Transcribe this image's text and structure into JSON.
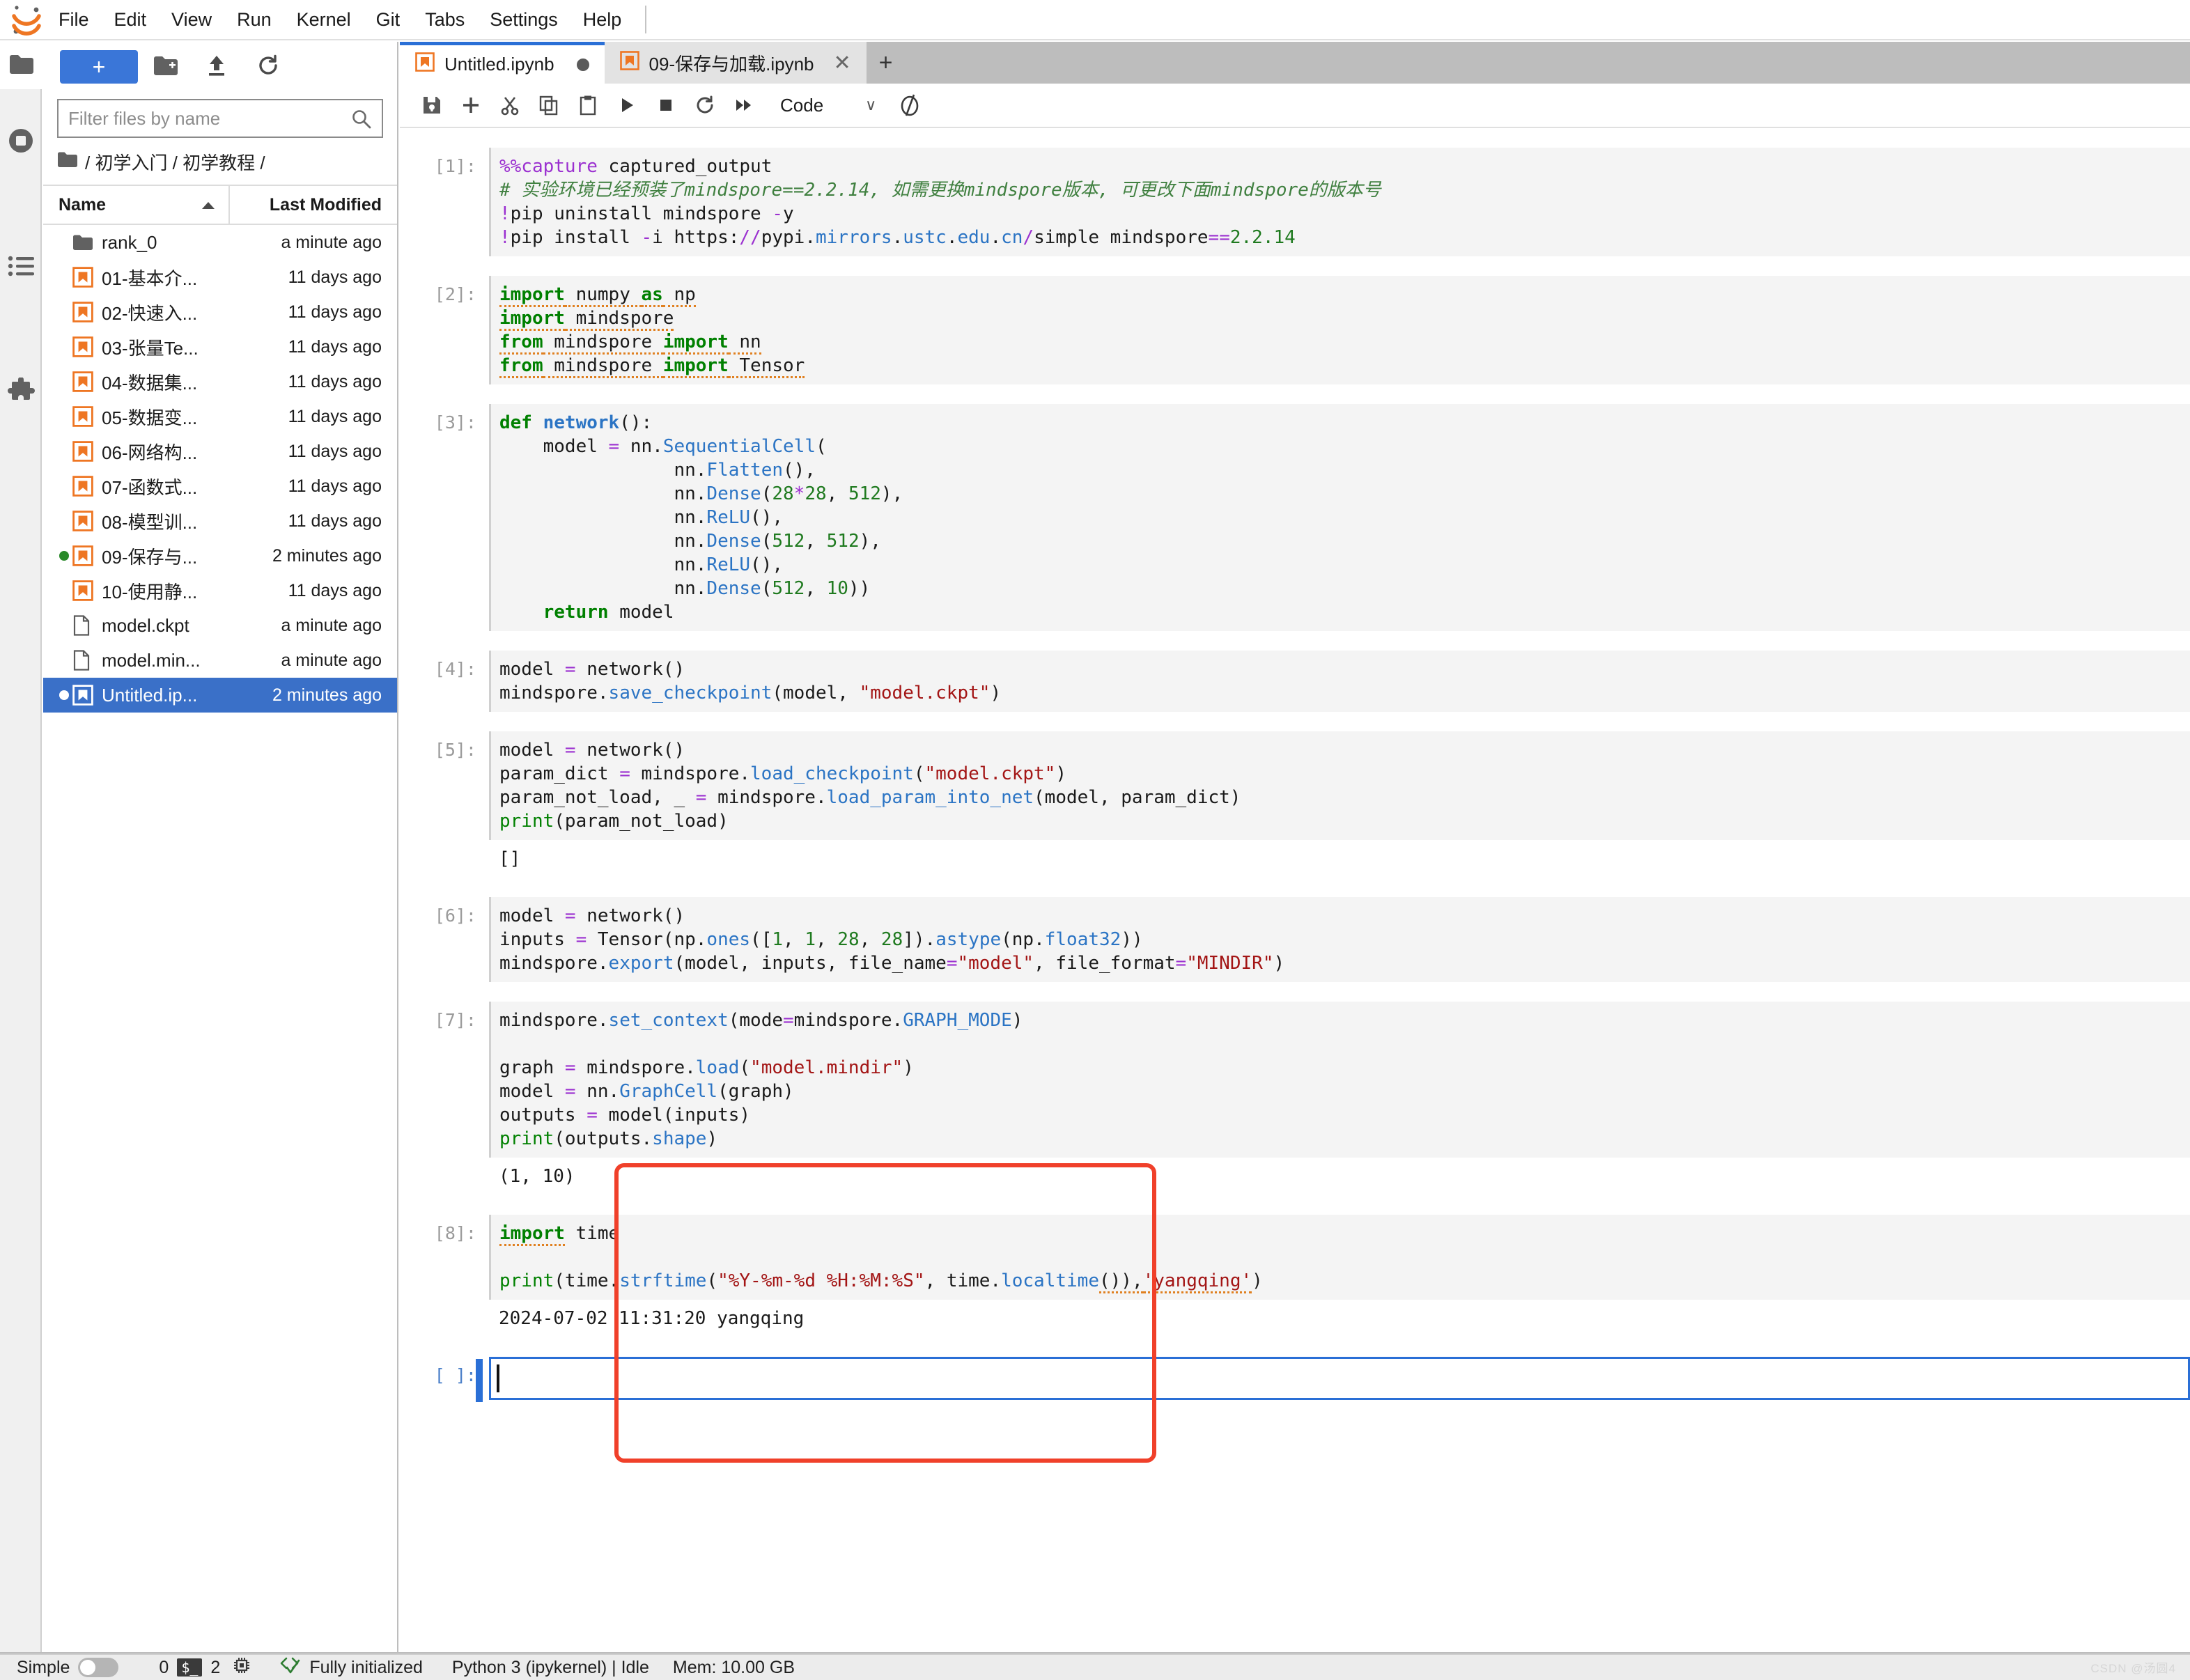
{
  "app": {
    "title": "JupyterLab",
    "logo_icon": "jupyter-logo-icon"
  },
  "menubar": {
    "items": [
      {
        "label": "File"
      },
      {
        "label": "Edit"
      },
      {
        "label": "View"
      },
      {
        "label": "Run"
      },
      {
        "label": "Kernel"
      },
      {
        "label": "Git"
      },
      {
        "label": "Tabs"
      },
      {
        "label": "Settings"
      },
      {
        "label": "Help"
      }
    ]
  },
  "rail": {
    "icons": [
      {
        "name": "folder-icon",
        "label": "File Browser"
      },
      {
        "name": "running-terminals-icon",
        "label": "Running Terminals and Kernels"
      },
      {
        "name": "commands-list-icon",
        "label": "Commands"
      },
      {
        "name": "extension-puzzle-icon",
        "label": "Extension Manager"
      }
    ]
  },
  "browser": {
    "new_launcher_label": "+",
    "toolbar_icons": [
      "new-folder-icon",
      "upload-icon",
      "refresh-icon"
    ],
    "search": {
      "placeholder": "Filter files by name",
      "value": "",
      "icon": "search-icon"
    },
    "breadcrumb": "/ 初学入门 / 初学教程 /",
    "columns": {
      "name": "Name",
      "last_modified": "Last Modified",
      "sort_icon": "sort-ascending-icon"
    },
    "files": [
      {
        "name": "rank_0",
        "modified": "a minute ago",
        "icon": "folder-icon",
        "dot": "none",
        "selected": false
      },
      {
        "name": "01-基本介...",
        "modified": "11 days ago",
        "icon": "notebook-icon",
        "dot": "none",
        "selected": false
      },
      {
        "name": "02-快速入...",
        "modified": "11 days ago",
        "icon": "notebook-icon",
        "dot": "none",
        "selected": false
      },
      {
        "name": "03-张量Te...",
        "modified": "11 days ago",
        "icon": "notebook-icon",
        "dot": "none",
        "selected": false
      },
      {
        "name": "04-数据集...",
        "modified": "11 days ago",
        "icon": "notebook-icon",
        "dot": "none",
        "selected": false
      },
      {
        "name": "05-数据变...",
        "modified": "11 days ago",
        "icon": "notebook-icon",
        "dot": "none",
        "selected": false
      },
      {
        "name": "06-网络构...",
        "modified": "11 days ago",
        "icon": "notebook-icon",
        "dot": "none",
        "selected": false
      },
      {
        "name": "07-函数式...",
        "modified": "11 days ago",
        "icon": "notebook-icon",
        "dot": "none",
        "selected": false
      },
      {
        "name": "08-模型训...",
        "modified": "11 days ago",
        "icon": "notebook-icon",
        "dot": "none",
        "selected": false
      },
      {
        "name": "09-保存与...",
        "modified": "2 minutes ago",
        "icon": "notebook-icon",
        "dot": "green",
        "selected": false
      },
      {
        "name": "10-使用静...",
        "modified": "11 days ago",
        "icon": "notebook-icon",
        "dot": "none",
        "selected": false
      },
      {
        "name": "model.ckpt",
        "modified": "a minute ago",
        "icon": "file-icon",
        "dot": "none",
        "selected": false
      },
      {
        "name": "model.min...",
        "modified": "a minute ago",
        "icon": "file-icon",
        "dot": "none",
        "selected": false
      },
      {
        "name": "Untitled.ip...",
        "modified": "2 minutes ago",
        "icon": "notebook-icon",
        "dot": "white",
        "selected": true
      }
    ]
  },
  "dock": {
    "tabs": [
      {
        "label": "Untitled.ipynb",
        "active": true,
        "dirty": true,
        "icon": "notebook-icon"
      },
      {
        "label": "09-保存与加载.ipynb",
        "active": false,
        "dirty": false,
        "icon": "notebook-icon",
        "close_label": "✕"
      }
    ],
    "add_tab_label": "+"
  },
  "notebook_toolbar": {
    "buttons": [
      {
        "name": "save-icon",
        "title": "Save"
      },
      {
        "name": "insert-cell-icon",
        "title": "Insert a cell below"
      },
      {
        "name": "cut-icon",
        "title": "Cut"
      },
      {
        "name": "copy-icon",
        "title": "Copy"
      },
      {
        "name": "paste-icon",
        "title": "Paste"
      },
      {
        "name": "run-icon",
        "title": "Run"
      },
      {
        "name": "stop-icon",
        "title": "Interrupt kernel"
      },
      {
        "name": "restart-icon",
        "title": "Restart kernel"
      },
      {
        "name": "restart-run-all-icon",
        "title": "Restart and run all"
      }
    ],
    "cell_type": {
      "value": "Code",
      "chevron": "∨"
    },
    "kernel_status_icon": "kernel-busy-circle-icon"
  },
  "cells": [
    {
      "prompt": "[1]:",
      "type": "code",
      "lines": [
        [
          {
            "t": "%%capture",
            "c": "mg"
          },
          {
            "t": " captured_output",
            "c": ""
          }
        ],
        [
          {
            "t": "# 实验环境已经预装了mindspore==2.2.14, 如需更换mindspore版本, 可更改下面mindspore的版本号",
            "c": "cm"
          }
        ],
        [
          {
            "t": "!",
            "c": "op"
          },
          {
            "t": "pip uninstall mindspore ",
            "c": ""
          },
          {
            "t": "-",
            "c": "op"
          },
          {
            "t": "y",
            "c": ""
          }
        ],
        [
          {
            "t": "!",
            "c": "op"
          },
          {
            "t": "pip install ",
            "c": ""
          },
          {
            "t": "-",
            "c": "op"
          },
          {
            "t": "i https:",
            "c": ""
          },
          {
            "t": "//",
            "c": "op"
          },
          {
            "t": "pypi.",
            "c": ""
          },
          {
            "t": "mirrors",
            "c": "fn"
          },
          {
            "t": ".",
            "c": ""
          },
          {
            "t": "ustc",
            "c": "fn"
          },
          {
            "t": ".",
            "c": ""
          },
          {
            "t": "edu",
            "c": "fn"
          },
          {
            "t": ".",
            "c": ""
          },
          {
            "t": "cn",
            "c": "fn"
          },
          {
            "t": "/",
            "c": "op"
          },
          {
            "t": "simple mindspore",
            "c": ""
          },
          {
            "t": "==",
            "c": "op"
          },
          {
            "t": "2.2.14",
            "c": "nu"
          }
        ]
      ],
      "output": null
    },
    {
      "prompt": "[2]:",
      "type": "code",
      "lines": [
        [
          {
            "t": "import",
            "c": "k lint"
          },
          {
            "t": " numpy ",
            "c": "lint"
          },
          {
            "t": "as",
            "c": "k lint"
          },
          {
            "t": " np",
            "c": "lint"
          }
        ],
        [
          {
            "t": "import",
            "c": "k lint"
          },
          {
            "t": " mindspore",
            "c": "lint"
          }
        ],
        [
          {
            "t": "from",
            "c": "k lint"
          },
          {
            "t": " mindspore ",
            "c": "lint"
          },
          {
            "t": "import",
            "c": "k lint"
          },
          {
            "t": " nn",
            "c": "lint"
          }
        ],
        [
          {
            "t": "from",
            "c": "k lint"
          },
          {
            "t": " mindspore ",
            "c": "lint"
          },
          {
            "t": "import",
            "c": "k lint"
          },
          {
            "t": " Tensor",
            "c": "lint"
          }
        ]
      ],
      "output": null
    },
    {
      "prompt": "[3]:",
      "type": "code",
      "lines": [
        [
          {
            "t": "def",
            "c": "k"
          },
          {
            "t": " ",
            "c": ""
          },
          {
            "t": "network",
            "c": "df"
          },
          {
            "t": "():",
            "c": ""
          }
        ],
        [
          {
            "t": "    model ",
            "c": ""
          },
          {
            "t": "=",
            "c": "op"
          },
          {
            "t": " nn.",
            "c": ""
          },
          {
            "t": "SequentialCell",
            "c": "fn"
          },
          {
            "t": "(",
            "c": ""
          }
        ],
        [
          {
            "t": "                nn.",
            "c": ""
          },
          {
            "t": "Flatten",
            "c": "fn"
          },
          {
            "t": "(),",
            "c": ""
          }
        ],
        [
          {
            "t": "                nn.",
            "c": ""
          },
          {
            "t": "Dense",
            "c": "fn"
          },
          {
            "t": "(",
            "c": ""
          },
          {
            "t": "28",
            "c": "nu"
          },
          {
            "t": "*",
            "c": "op"
          },
          {
            "t": "28",
            "c": "nu"
          },
          {
            "t": ", ",
            "c": ""
          },
          {
            "t": "512",
            "c": "nu"
          },
          {
            "t": "),",
            "c": ""
          }
        ],
        [
          {
            "t": "                nn.",
            "c": ""
          },
          {
            "t": "ReLU",
            "c": "fn"
          },
          {
            "t": "(),",
            "c": ""
          }
        ],
        [
          {
            "t": "                nn.",
            "c": ""
          },
          {
            "t": "Dense",
            "c": "fn"
          },
          {
            "t": "(",
            "c": ""
          },
          {
            "t": "512",
            "c": "nu"
          },
          {
            "t": ", ",
            "c": ""
          },
          {
            "t": "512",
            "c": "nu"
          },
          {
            "t": "),",
            "c": ""
          }
        ],
        [
          {
            "t": "                nn.",
            "c": ""
          },
          {
            "t": "ReLU",
            "c": "fn"
          },
          {
            "t": "(),",
            "c": ""
          }
        ],
        [
          {
            "t": "                nn.",
            "c": ""
          },
          {
            "t": "Dense",
            "c": "fn"
          },
          {
            "t": "(",
            "c": ""
          },
          {
            "t": "512",
            "c": "nu"
          },
          {
            "t": ", ",
            "c": ""
          },
          {
            "t": "10",
            "c": "nu"
          },
          {
            "t": "))",
            "c": ""
          }
        ],
        [
          {
            "t": "    ",
            "c": ""
          },
          {
            "t": "return",
            "c": "k"
          },
          {
            "t": " model",
            "c": ""
          }
        ]
      ],
      "output": null
    },
    {
      "prompt": "[4]:",
      "type": "code",
      "lines": [
        [
          {
            "t": "model ",
            "c": ""
          },
          {
            "t": "=",
            "c": "op"
          },
          {
            "t": " network()",
            "c": ""
          }
        ],
        [
          {
            "t": "mindspore.",
            "c": ""
          },
          {
            "t": "save_checkpoint",
            "c": "fn"
          },
          {
            "t": "(model, ",
            "c": ""
          },
          {
            "t": "\"model.ckpt\"",
            "c": "st"
          },
          {
            "t": ")",
            "c": ""
          }
        ]
      ],
      "output": null
    },
    {
      "prompt": "[5]:",
      "type": "code",
      "lines": [
        [
          {
            "t": "model ",
            "c": ""
          },
          {
            "t": "=",
            "c": "op"
          },
          {
            "t": " network()",
            "c": ""
          }
        ],
        [
          {
            "t": "param_dict ",
            "c": ""
          },
          {
            "t": "=",
            "c": "op"
          },
          {
            "t": " mindspore.",
            "c": ""
          },
          {
            "t": "load_checkpoint",
            "c": "fn"
          },
          {
            "t": "(",
            "c": ""
          },
          {
            "t": "\"model.ckpt\"",
            "c": "st"
          },
          {
            "t": ")",
            "c": ""
          }
        ],
        [
          {
            "t": "param_not_load, _ ",
            "c": ""
          },
          {
            "t": "=",
            "c": "op"
          },
          {
            "t": " mindspore.",
            "c": ""
          },
          {
            "t": "load_param_into_net",
            "c": "fn"
          },
          {
            "t": "(model, param_dict)",
            "c": ""
          }
        ],
        [
          {
            "t": "print",
            "c": "kw"
          },
          {
            "t": "(param_not_load)",
            "c": ""
          }
        ]
      ],
      "output": "[]"
    },
    {
      "prompt": "[6]:",
      "type": "code",
      "lines": [
        [
          {
            "t": "model ",
            "c": ""
          },
          {
            "t": "=",
            "c": "op"
          },
          {
            "t": " network()",
            "c": ""
          }
        ],
        [
          {
            "t": "inputs ",
            "c": ""
          },
          {
            "t": "=",
            "c": "op"
          },
          {
            "t": " Tensor(np.",
            "c": ""
          },
          {
            "t": "ones",
            "c": "fn"
          },
          {
            "t": "([",
            "c": ""
          },
          {
            "t": "1",
            "c": "nu"
          },
          {
            "t": ", ",
            "c": ""
          },
          {
            "t": "1",
            "c": "nu"
          },
          {
            "t": ", ",
            "c": ""
          },
          {
            "t": "28",
            "c": "nu"
          },
          {
            "t": ", ",
            "c": ""
          },
          {
            "t": "28",
            "c": "nu"
          },
          {
            "t": "]).",
            "c": ""
          },
          {
            "t": "astype",
            "c": "fn"
          },
          {
            "t": "(np.",
            "c": ""
          },
          {
            "t": "float32",
            "c": "fn"
          },
          {
            "t": "))",
            "c": ""
          }
        ],
        [
          {
            "t": "mindspore.",
            "c": ""
          },
          {
            "t": "export",
            "c": "fn"
          },
          {
            "t": "(model, inputs, file_name",
            "c": ""
          },
          {
            "t": "=",
            "c": "op"
          },
          {
            "t": "\"model\"",
            "c": "st"
          },
          {
            "t": ", file_format",
            "c": ""
          },
          {
            "t": "=",
            "c": "op"
          },
          {
            "t": "\"MINDIR\"",
            "c": "st"
          },
          {
            "t": ")",
            "c": ""
          }
        ]
      ],
      "output": null
    },
    {
      "prompt": "[7]:",
      "type": "code",
      "lines": [
        [
          {
            "t": "mindspore.",
            "c": ""
          },
          {
            "t": "set_context",
            "c": "fn"
          },
          {
            "t": "(mode",
            "c": ""
          },
          {
            "t": "=",
            "c": "op"
          },
          {
            "t": "mindspore.",
            "c": ""
          },
          {
            "t": "GRAPH_MODE",
            "c": "fn"
          },
          {
            "t": ")",
            "c": ""
          }
        ],
        [
          {
            "t": "",
            "c": ""
          }
        ],
        [
          {
            "t": "graph ",
            "c": ""
          },
          {
            "t": "=",
            "c": "op"
          },
          {
            "t": " mindspore.",
            "c": ""
          },
          {
            "t": "load",
            "c": "fn"
          },
          {
            "t": "(",
            "c": ""
          },
          {
            "t": "\"model.mindir\"",
            "c": "st"
          },
          {
            "t": ")",
            "c": ""
          }
        ],
        [
          {
            "t": "model ",
            "c": ""
          },
          {
            "t": "=",
            "c": "op"
          },
          {
            "t": " nn.",
            "c": ""
          },
          {
            "t": "GraphCell",
            "c": "fn"
          },
          {
            "t": "(graph)",
            "c": ""
          }
        ],
        [
          {
            "t": "outputs ",
            "c": ""
          },
          {
            "t": "=",
            "c": "op"
          },
          {
            "t": " model(inputs)",
            "c": ""
          }
        ],
        [
          {
            "t": "print",
            "c": "kw"
          },
          {
            "t": "(outputs.",
            "c": ""
          },
          {
            "t": "shape",
            "c": "fn"
          },
          {
            "t": ")",
            "c": ""
          }
        ]
      ],
      "output": "(1, 10)"
    },
    {
      "prompt": "[8]:",
      "type": "code",
      "lines": [
        [
          {
            "t": "import",
            "c": "k lint"
          },
          {
            "t": " time",
            "c": ""
          }
        ],
        [
          {
            "t": "",
            "c": ""
          }
        ],
        [
          {
            "t": "print",
            "c": "kw"
          },
          {
            "t": "(time.",
            "c": ""
          },
          {
            "t": "strftime",
            "c": "fn"
          },
          {
            "t": "(",
            "c": ""
          },
          {
            "t": "\"%Y-%m-%d %H:%M:%S\"",
            "c": "st"
          },
          {
            "t": ", time.",
            "c": ""
          },
          {
            "t": "localtime",
            "c": "fn"
          },
          {
            "t": "()),",
            "c": "lint"
          },
          {
            "t": "'yangqing'",
            "c": "st lint"
          },
          {
            "t": ")",
            "c": ""
          }
        ]
      ],
      "output": "2024-07-02 11:31:20 yangqing"
    },
    {
      "prompt": "[ ]:",
      "type": "active-empty",
      "lines": [],
      "output": null
    }
  ],
  "statusbar": {
    "simple_label": "Simple",
    "simple_on": false,
    "kernel_count": "0",
    "terminal_badge": "$_",
    "terminal_count": "2",
    "kernel_icon": "cpu-chip-icon",
    "git_icon": "code-check-icon",
    "git_status": "Fully initialized",
    "kernel_info": "Python 3 (ipykernel) | Idle",
    "memory": "Mem: 10.00 GB"
  },
  "watermark": "CSDN @汤圆4"
}
